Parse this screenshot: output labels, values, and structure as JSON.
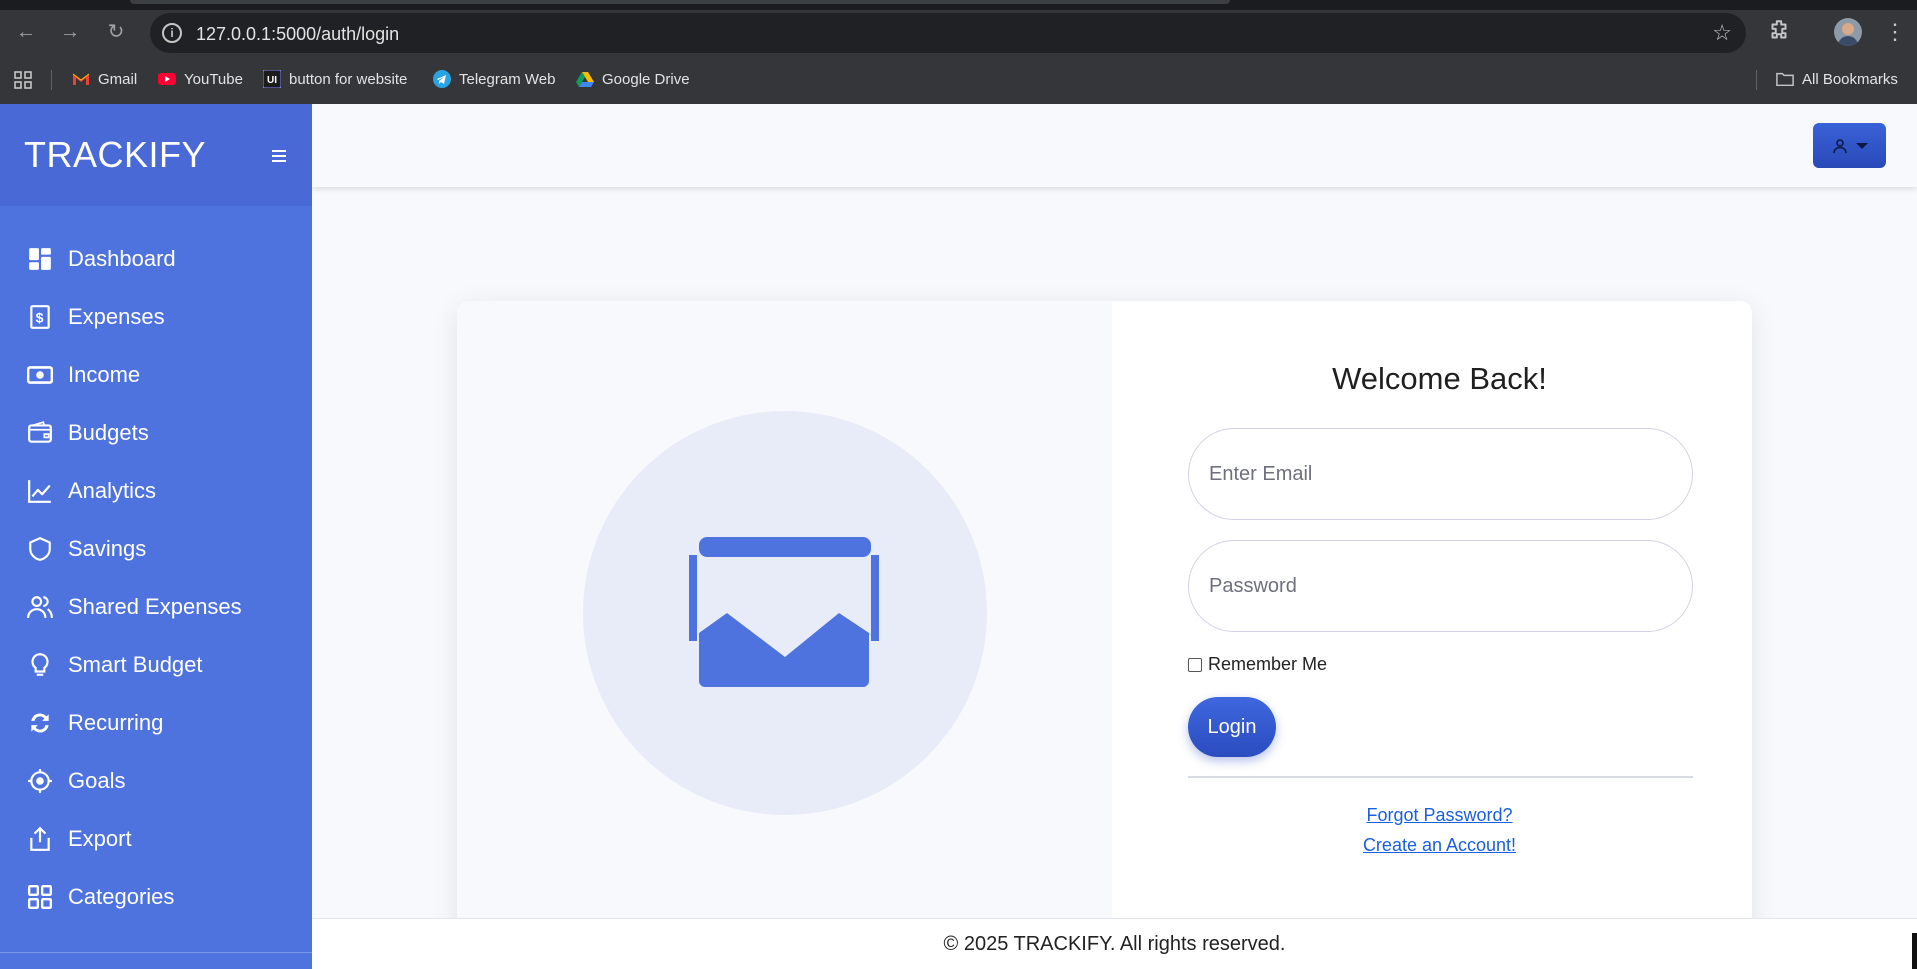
{
  "browser": {
    "url": "127.0.0.1:5000/auth/login",
    "bookmarks": [
      {
        "label": "Gmail",
        "icon": "gmail-icon"
      },
      {
        "label": "YouTube",
        "icon": "youtube-icon"
      },
      {
        "label": "button for website",
        "icon": "uiverse-icon"
      },
      {
        "label": "Telegram Web",
        "icon": "telegram-icon"
      },
      {
        "label": "Google Drive",
        "icon": "google-drive-icon"
      }
    ],
    "all_bookmarks": "All Bookmarks"
  },
  "sidebar": {
    "brand": "TRACKIFY",
    "items": [
      {
        "label": "Dashboard",
        "icon": "dashboard-icon"
      },
      {
        "label": "Expenses",
        "icon": "receipt-icon"
      },
      {
        "label": "Income",
        "icon": "money-icon"
      },
      {
        "label": "Budgets",
        "icon": "wallet-icon"
      },
      {
        "label": "Analytics",
        "icon": "line-chart-icon"
      },
      {
        "label": "Savings",
        "icon": "shield-icon"
      },
      {
        "label": "Shared Expenses",
        "icon": "users-icon"
      },
      {
        "label": "Smart Budget",
        "icon": "lightbulb-icon"
      },
      {
        "label": "Recurring",
        "icon": "sync-icon"
      },
      {
        "label": "Goals",
        "icon": "target-icon"
      },
      {
        "label": "Export",
        "icon": "export-icon"
      },
      {
        "label": "Categories",
        "icon": "grid-icon"
      }
    ]
  },
  "login": {
    "title": "Welcome Back!",
    "email_placeholder": "Enter Email",
    "password_placeholder": "Password",
    "remember_label": "Remember Me",
    "login_button": "Login",
    "forgot_link": "Forgot Password?",
    "create_link": "Create an Account!"
  },
  "footer": {
    "text": "© 2025 TRACKIFY. All rights reserved."
  },
  "colors": {
    "sidebar": "#4e73df",
    "brand_bar": "#4869d6",
    "primary_button": "#2f55d0",
    "link": "#1a5fe0",
    "page_bg": "#f8f9fc",
    "illustration_circle": "#e8ecf8"
  }
}
